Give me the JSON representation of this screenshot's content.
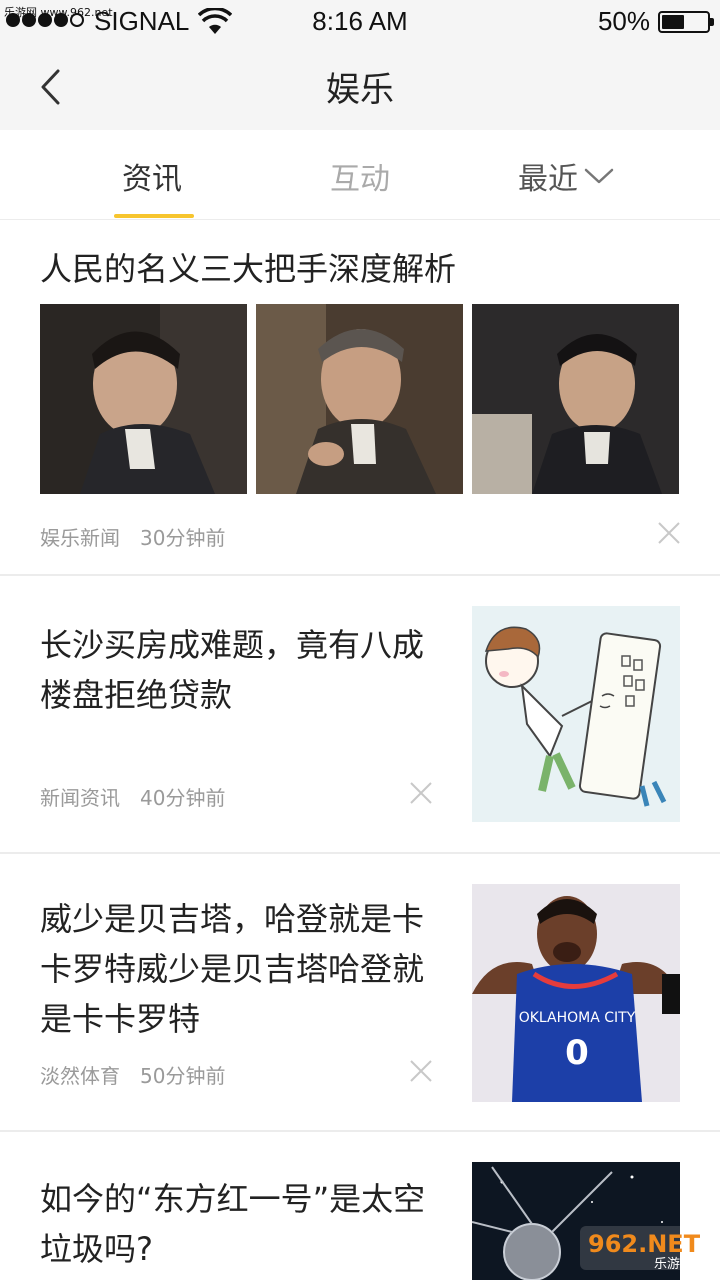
{
  "status_bar": {
    "carrier": "SIGNAL",
    "time": "8:16 AM",
    "battery_percent": "50%",
    "battery_level": 0.5,
    "watermark_top": "乐游网 www.962.net"
  },
  "nav": {
    "title": "娱乐",
    "back_icon": "chevron-left-icon"
  },
  "tabs": [
    {
      "label": "资讯",
      "active": true
    },
    {
      "label": "互动",
      "active": false
    },
    {
      "label": "最近",
      "active": false
    }
  ],
  "accent_color": "#f7c52e",
  "articles": [
    {
      "title": "人民的名义三大把手深度解析",
      "source": "娱乐新闻",
      "time": "30分钟前"
    },
    {
      "title": "长沙买房成难题，竟有八成楼盘拒绝贷款",
      "source": "新闻资讯",
      "time": "40分钟前"
    },
    {
      "title": "威少是贝吉塔，哈登就是卡卡罗特威少是贝吉塔哈登就是卡卡罗特",
      "source": "淡然体育",
      "time": "50分钟前",
      "jersey_text": "OKLAHOMA CITY",
      "jersey_number": "0"
    },
    {
      "title": "如今的“东方红一号”是太空垃圾吗?"
    }
  ],
  "watermark": {
    "brand": "962.NET",
    "sub": "乐游网"
  }
}
